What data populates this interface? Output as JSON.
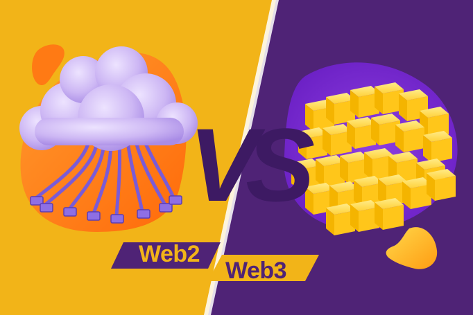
{
  "versus_label": "VS",
  "web2": {
    "label": "Web2",
    "icon": "cloud-network-icon"
  },
  "web3": {
    "label": "Web3",
    "icon": "blockchain-cubes-icon"
  },
  "colors": {
    "yellow_bg": "#F2B418",
    "purple_bg": "#4F2376",
    "orange_blob": "#FF7A14",
    "cloud_lavender": "#CDB7F4",
    "cable_purple": "#7A5BD6",
    "cube_yellow": "#FFD23A",
    "divider": "#FFFFFF"
  }
}
